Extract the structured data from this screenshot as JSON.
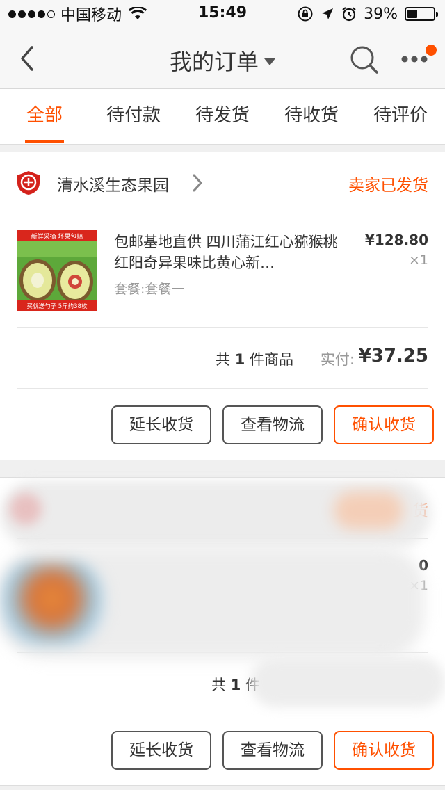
{
  "status_bar": {
    "carrier": "中国移动",
    "time": "15:49",
    "battery": "39%",
    "battery_level": 0.39
  },
  "nav": {
    "title": "我的订单"
  },
  "tabs": [
    {
      "label": "全部",
      "active": true
    },
    {
      "label": "待付款",
      "active": false
    },
    {
      "label": "待发货",
      "active": false
    },
    {
      "label": "待收货",
      "active": false
    },
    {
      "label": "待评价",
      "active": false
    }
  ],
  "orders": [
    {
      "shop_name": "清水溪生态果园",
      "status": "卖家已发货",
      "item_title": "包邮基地直供 四川蒲江红心猕猴桃 红阳奇异果味比黄心新…",
      "sku": "套餐:套餐一",
      "price": "¥128.80",
      "qty": "×1",
      "count_prefix": "共 ",
      "count_num": "1",
      "count_suffix": " 件商品",
      "paid_label": "实付:",
      "paid_value": "¥37.25",
      "thumb_top_text": "新鲜采摘  坏果包赔",
      "thumb_bottom_text": "买就送勺子 5斤约38枚",
      "buttons": {
        "extend": "延长收货",
        "logistics": "查看物流",
        "confirm": "确认收货"
      }
    },
    {
      "status_partial": "货",
      "price_partial": "0",
      "qty_partial": "×1",
      "count_prefix": "共 ",
      "count_num": "1",
      "count_suffix": " 件",
      "buttons": {
        "extend": "延长收货",
        "logistics": "查看物流",
        "confirm": "确认收货"
      }
    }
  ],
  "colors": {
    "accent": "#ff5000",
    "text": "#333333",
    "muted": "#999999",
    "background": "#f0f0f0"
  }
}
